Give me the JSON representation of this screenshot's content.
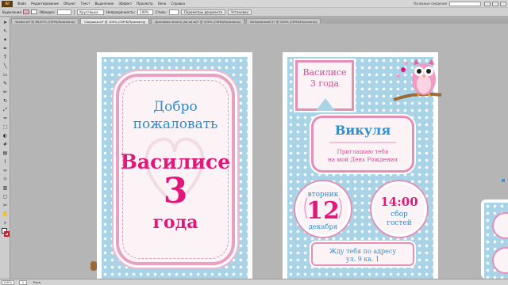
{
  "menubar": {
    "logo": "Ai",
    "items": [
      "Файл",
      "Редактирование",
      "Объект",
      "Текст",
      "Выделение",
      "Эффект",
      "Просмотр",
      "Окно",
      "Справка"
    ],
    "workspace": "Основные сведения"
  },
  "control": {
    "selection_label": "Выделения",
    "stroke_label": "Обводка:",
    "brush_label": "Кругляшка",
    "opacity_label": "Непрозрачность:",
    "opacity_value": "100%",
    "style_label": "Стиль:",
    "doc_settings_button": "Параметры документа",
    "prefs_button": "Установки"
  },
  "tabs": [
    {
      "label": "Vestka.ai* @ 66,67% (CMYK/Просмотр)",
      "active": false
    },
    {
      "label": "Совушки.ai* @ 100% (CMYK/Просмотр)",
      "active": true
    },
    {
      "label": "Дипломы печать (A4 a4.ai)* @ 100% (CMYK/Просмотр)",
      "active": false
    },
    {
      "label": "Безымянный-1* @ 100% (CMYK/Просмотр)",
      "active": false
    }
  ],
  "status": {
    "zoom": "100%",
    "page": "1",
    "tool": "Рука"
  },
  "card1": {
    "welcome_line1": "Добро",
    "welcome_line2": "пожаловать",
    "name": "Василисе",
    "age": "3",
    "years": "года"
  },
  "card2": {
    "flag_name": "Василисе",
    "flag_age": "3 года",
    "sender": "Викуля",
    "invite_line1": "Приглашаю тебя",
    "invite_line2": "на мой День Рождения",
    "weekday": "вторник",
    "day": "12",
    "month": "декабря",
    "time": "14:00",
    "gather_line1": "сбор",
    "gather_line2": "гостей",
    "address_line1": "Жду тебя по адресу",
    "address_line2": "ул. 9 кв. 1"
  },
  "colors": {
    "pink": "#e3177a",
    "blue": "#2a8fd0",
    "background_blue": "#a9d4e8",
    "frame_pink": "#e48fb6"
  }
}
